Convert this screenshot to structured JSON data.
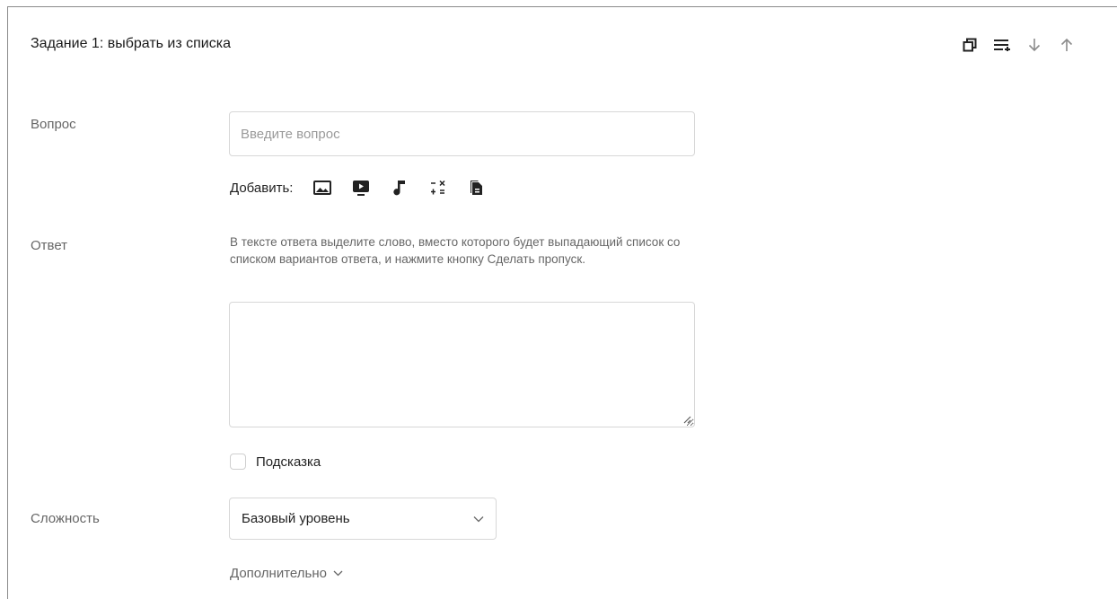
{
  "task": {
    "title": "Задание 1: выбрать из списка"
  },
  "toolbar": {
    "icons": [
      "copy-icon",
      "list-add-icon",
      "arrow-down-icon",
      "arrow-up-icon"
    ]
  },
  "question": {
    "label": "Вопрос",
    "placeholder": "Введите вопрос",
    "value": ""
  },
  "add_media": {
    "label": "Добавить:",
    "icons": [
      "image-icon",
      "video-icon",
      "audio-icon",
      "formula-icon",
      "document-icon"
    ]
  },
  "answer": {
    "label": "Ответ",
    "hint": "В тексте ответа выделите слово, вместо которого будет выпадающий список со списком вариантов ответа, и нажмите кнопку Сделать пропуск.",
    "value": ""
  },
  "hint_checkbox": {
    "label": "Подсказка",
    "checked": false
  },
  "difficulty": {
    "label": "Сложность",
    "selected": "Базовый уровень"
  },
  "additional": {
    "label": "Дополнительно"
  }
}
